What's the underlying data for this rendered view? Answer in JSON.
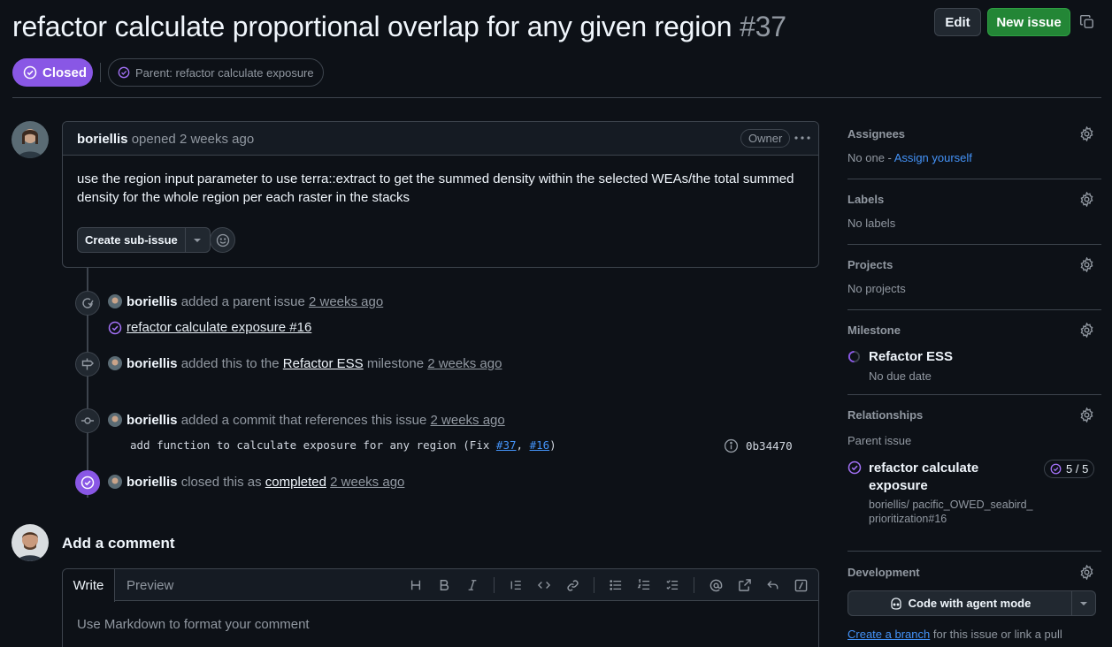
{
  "issue": {
    "title": "refactor calculate proportional overlap for any given region",
    "number": "#37",
    "state": "Closed",
    "parent_label": "Parent: refactor calculate exposure"
  },
  "header": {
    "edit_label": "Edit",
    "new_issue_label": "New issue"
  },
  "comment": {
    "author": "boriellis",
    "action": "opened",
    "time": "2 weeks ago",
    "role_badge": "Owner",
    "body": "use the region input parameter to use terra::extract to get the summed density within the selected WEAs/the total summed density for the whole region per each raster in the stacks",
    "create_sub_issue_label": "Create sub-issue"
  },
  "timeline": [
    {
      "actor": "boriellis",
      "text": "added a parent issue",
      "time": "2 weeks ago",
      "sub_link": "refactor calculate exposure #16"
    },
    {
      "actor": "boriellis",
      "text_pre": "added this to the",
      "milestone": "Refactor ESS",
      "text_post": "milestone",
      "time": "2 weeks ago"
    },
    {
      "actor": "boriellis",
      "text": "added a commit that references this issue",
      "time": "2 weeks ago",
      "commit_msg_pre": "add function to calculate exposure for any region (Fix ",
      "commit_ref1": "#37",
      "commit_sep": ", ",
      "commit_ref2": "#16",
      "commit_msg_post": ")",
      "commit_sha": "0b34470"
    },
    {
      "actor": "boriellis",
      "text_pre": "closed this as",
      "state_word": "completed",
      "time": "2 weeks ago"
    }
  ],
  "add_comment": {
    "title": "Add a comment",
    "tab_write": "Write",
    "tab_preview": "Preview",
    "placeholder": "Use Markdown to format your comment"
  },
  "sidebar": {
    "assignees": {
      "title": "Assignees",
      "value_prefix": "No one - ",
      "assign_link": "Assign yourself"
    },
    "labels": {
      "title": "Labels",
      "value": "No labels"
    },
    "projects": {
      "title": "Projects",
      "value": "No projects"
    },
    "milestone": {
      "title": "Milestone",
      "name": "Refactor ESS",
      "due": "No due date"
    },
    "relationships": {
      "title": "Relationships",
      "parent_label": "Parent issue",
      "parent_title": "refactor calculate exposure",
      "parent_count": "5 / 5",
      "parent_repo": "boriellis/ pacific_OWED_seabird_prioritization#16"
    },
    "development": {
      "title": "Development",
      "agent_button": "Code with agent mode",
      "create_branch_link": "Create a branch",
      "create_branch_rest": " for this issue or link a pull"
    }
  },
  "colors": {
    "closed_purple": "#8957e5",
    "primary_green": "#238636",
    "link_blue": "#4493f8",
    "background": "#0d1117"
  }
}
